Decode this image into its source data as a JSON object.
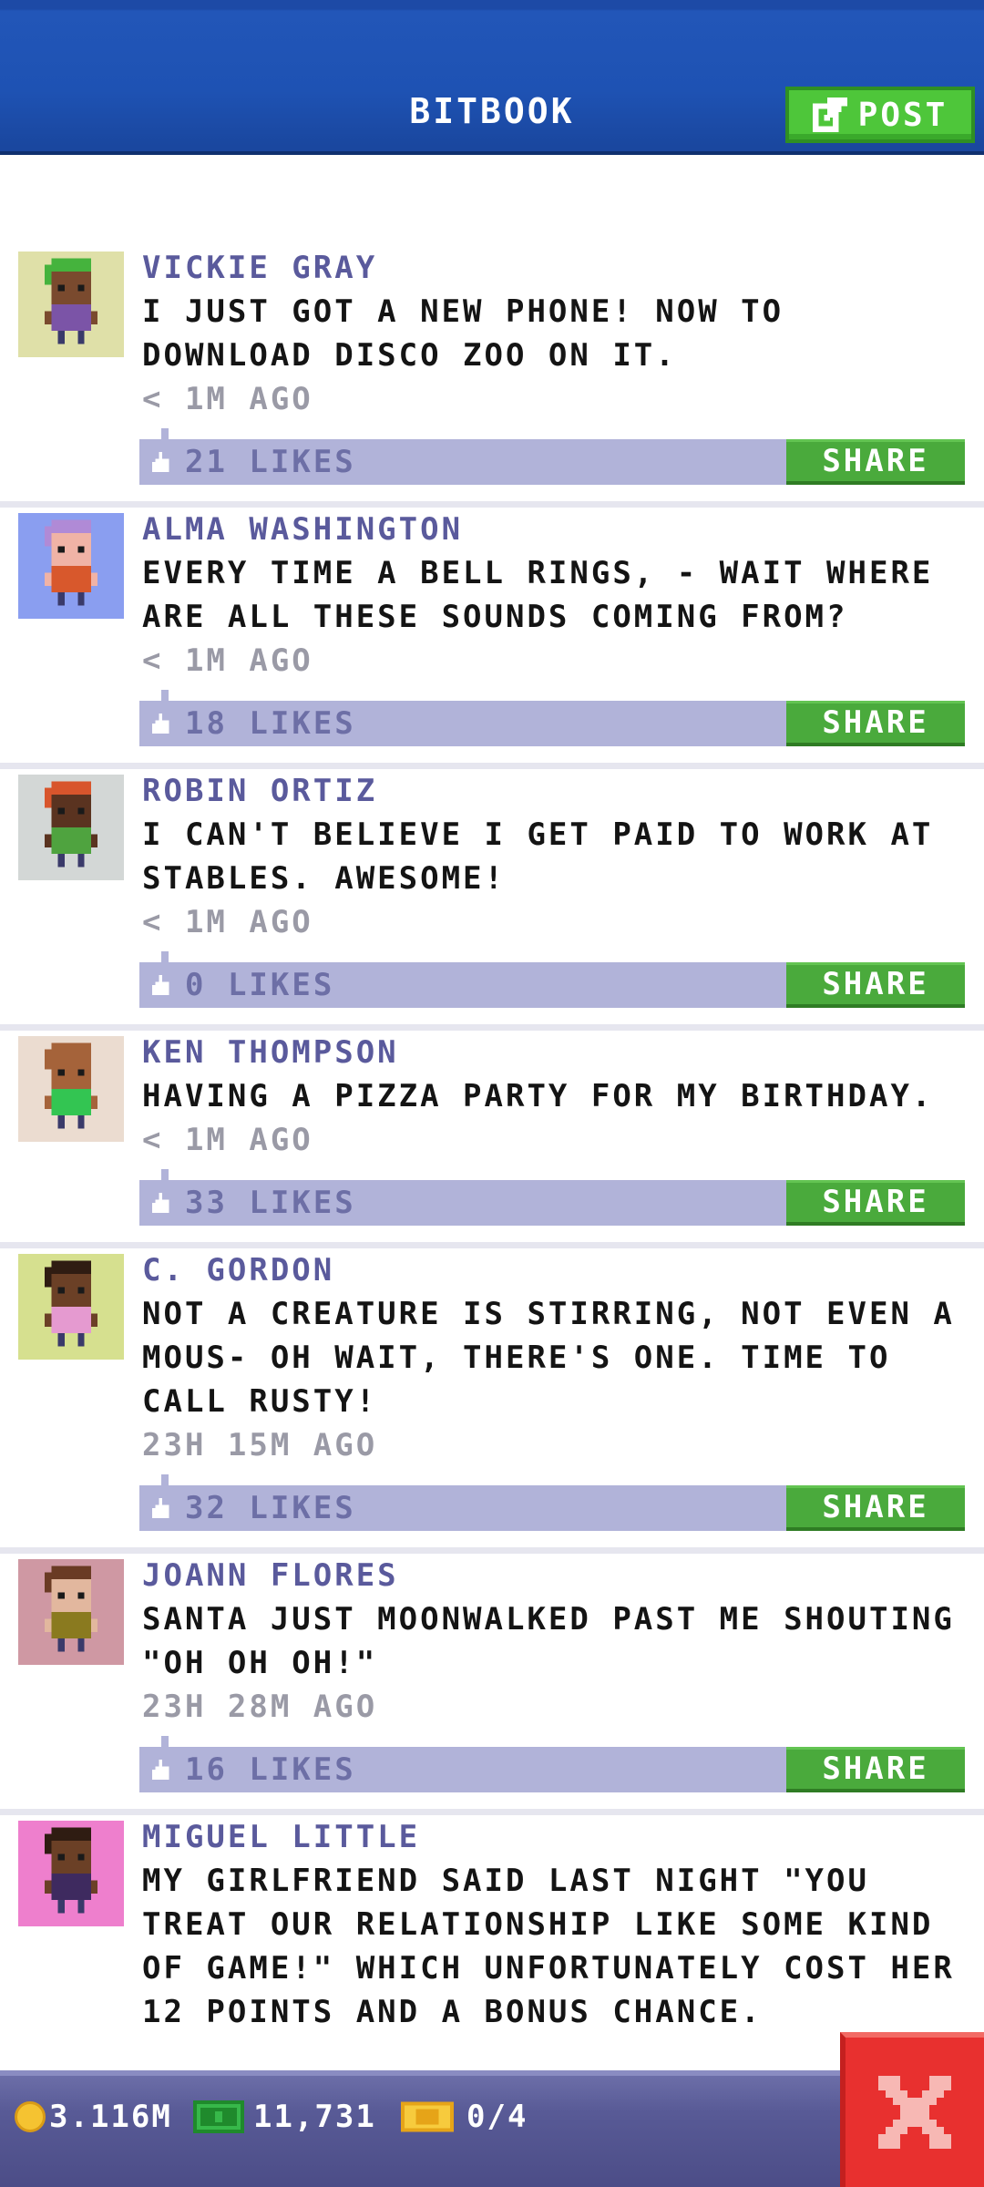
{
  "header": {
    "title": "BITBOOK",
    "post_label": "POST"
  },
  "colors": {
    "header_blue": "#1e52b3",
    "accent_green": "#4ec63a",
    "name_purple": "#5a5a9c",
    "likes_bar": "#b1b3d9",
    "close_red": "#e8302f"
  },
  "posts": [
    {
      "name": "VICKIE GRAY",
      "message": "I JUST GOT A NEW PHONE! NOW TO DOWNLOAD DISCO ZOO ON IT.",
      "time": "< 1M AGO",
      "likes": "21 LIKES",
      "share": "SHARE",
      "avatar_bg": "#dfe0a8",
      "skin": "#7a4a2e",
      "hair": "#45b33d",
      "shirt": "#7b54a7"
    },
    {
      "name": "ALMA WASHINGTON",
      "message": "EVERY TIME A BELL RINGS, - WAIT WHERE ARE ALL THESE SOUNDS COMING FROM?",
      "time": "< 1M AGO",
      "likes": "18 LIKES",
      "share": "SHARE",
      "avatar_bg": "#8a9ef0",
      "skin": "#f0b3a6",
      "hair": "#b08ad6",
      "shirt": "#d8582c"
    },
    {
      "name": "ROBIN ORTIZ",
      "message": "I CAN'T BELIEVE I GET PAID TO WORK AT STABLES. AWESOME!",
      "time": "< 1M AGO",
      "likes": "0 LIKES",
      "share": "SHARE",
      "avatar_bg": "#d3d7d6",
      "skin": "#5a3320",
      "hair": "#d8552c",
      "shirt": "#4fa33f"
    },
    {
      "name": "KEN THOMPSON",
      "message": "HAVING A PIZZA PARTY FOR MY BIRTHDAY.",
      "time": "< 1M AGO",
      "likes": "33 LIKES",
      "share": "SHARE",
      "avatar_bg": "#ebdcd0",
      "skin": "#a5633a",
      "hair": "#a5633a",
      "shirt": "#33c552"
    },
    {
      "name": "C. GORDON",
      "message": "NOT A CREATURE IS STIRRING, NOT EVEN A MOUS- OH WAIT, THERE'S ONE. TIME TO CALL RUSTY!",
      "time": "23H 15M AGO",
      "likes": "32 LIKES",
      "share": "SHARE",
      "avatar_bg": "#d6e08f",
      "skin": "#6b4026",
      "hair": "#2f1c12",
      "shirt": "#e59ad0"
    },
    {
      "name": "JOANN FLORES",
      "message": "SANTA JUST MOONWALKED PAST ME SHOUTING \"OH OH OH!\"",
      "time": "23H 28M AGO",
      "likes": "16 LIKES",
      "share": "SHARE",
      "avatar_bg": "#cf98a3",
      "skin": "#e2b79e",
      "hair": "#6a3b24",
      "shirt": "#8a7a1f"
    },
    {
      "name": "MIGUEL LITTLE",
      "message": "MY GIRLFRIEND SAID LAST NIGHT \"YOU TREAT OUR RELATIONSHIP LIKE SOME KIND OF GAME!\" WHICH UNFORTUNATELY COST HER 12 POINTS AND A BONUS CHANCE.",
      "time": "",
      "likes": "",
      "share": "",
      "avatar_bg": "#ee7fcd",
      "skin": "#6b4026",
      "hair": "#2f1c12",
      "shirt": "#3e2a5f"
    }
  ],
  "bottom_bar": {
    "coins": "3.116M",
    "cash": "11,731",
    "tickets": "0/4"
  }
}
